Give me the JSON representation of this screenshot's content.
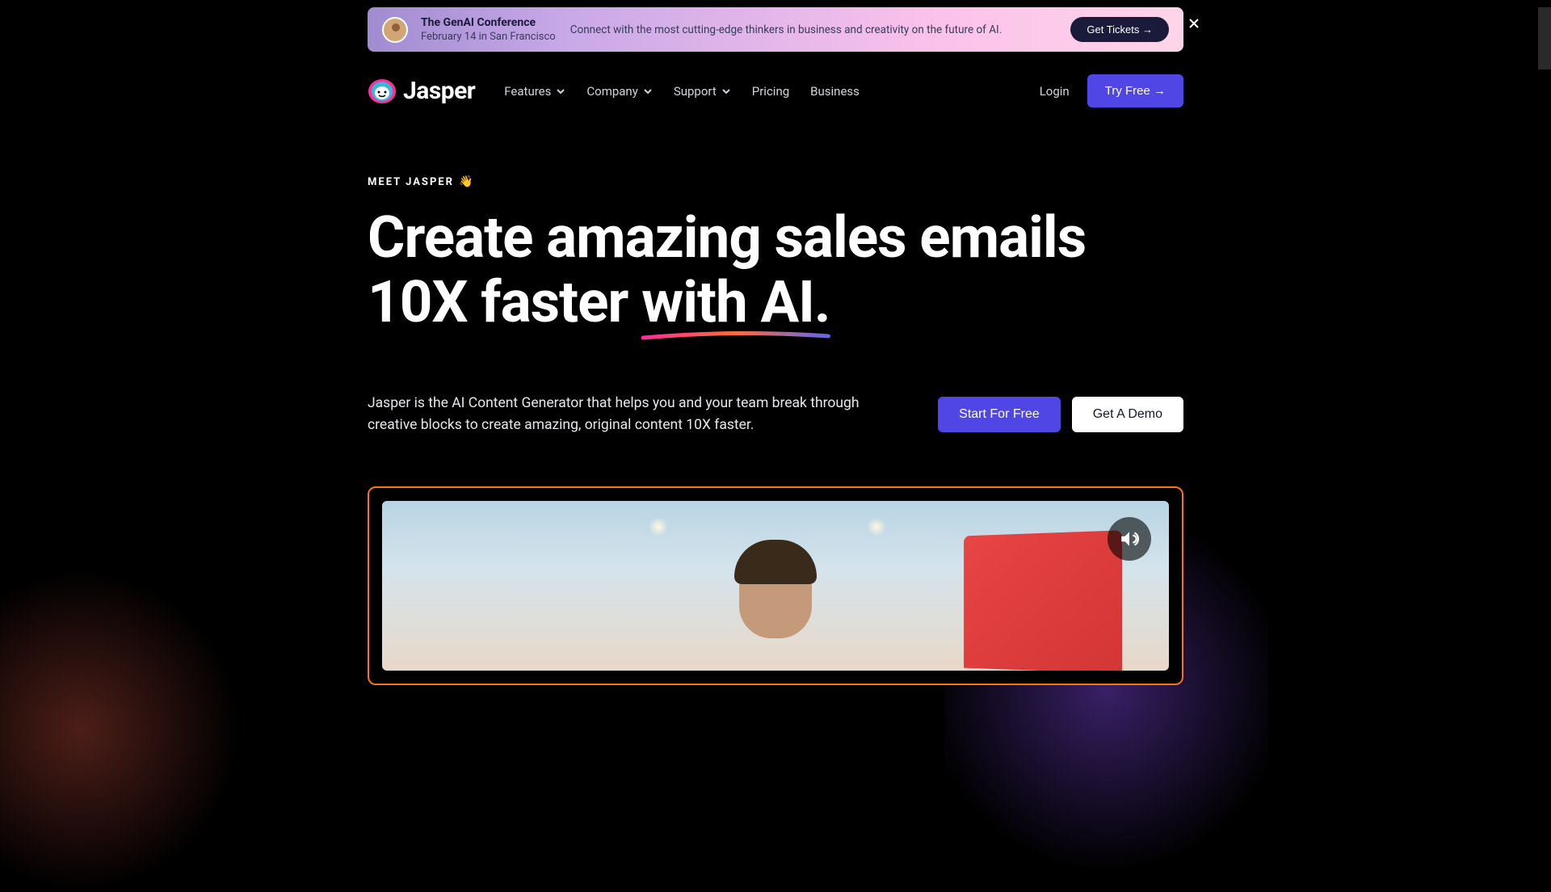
{
  "banner": {
    "title": "The GenAI Conference",
    "subtitle": "February 14 in San Francisco",
    "description": "Connect with the most cutting-edge thinkers in business and creativity on the future of AI.",
    "cta": "Get Tickets →"
  },
  "brand": {
    "name": "Jasper"
  },
  "nav": {
    "items": [
      {
        "label": "Features",
        "hasDropdown": true
      },
      {
        "label": "Company",
        "hasDropdown": true
      },
      {
        "label": "Support",
        "hasDropdown": true
      },
      {
        "label": "Pricing",
        "hasDropdown": false
      },
      {
        "label": "Business",
        "hasDropdown": false
      }
    ],
    "login": "Login",
    "tryFree": "Try Free →"
  },
  "hero": {
    "meetLabel": "MEET JASPER",
    "waveEmoji": "👋",
    "titleLine1": "Create amazing sales emails",
    "titleLine2Start": "10X faster ",
    "titleLine2Underlined": "with AI.",
    "description": "Jasper is the AI Content Generator that helps you and your team break through creative blocks to create amazing, original content 10X faster.",
    "startCta": "Start For Free",
    "demoCta": "Get A Demo"
  }
}
